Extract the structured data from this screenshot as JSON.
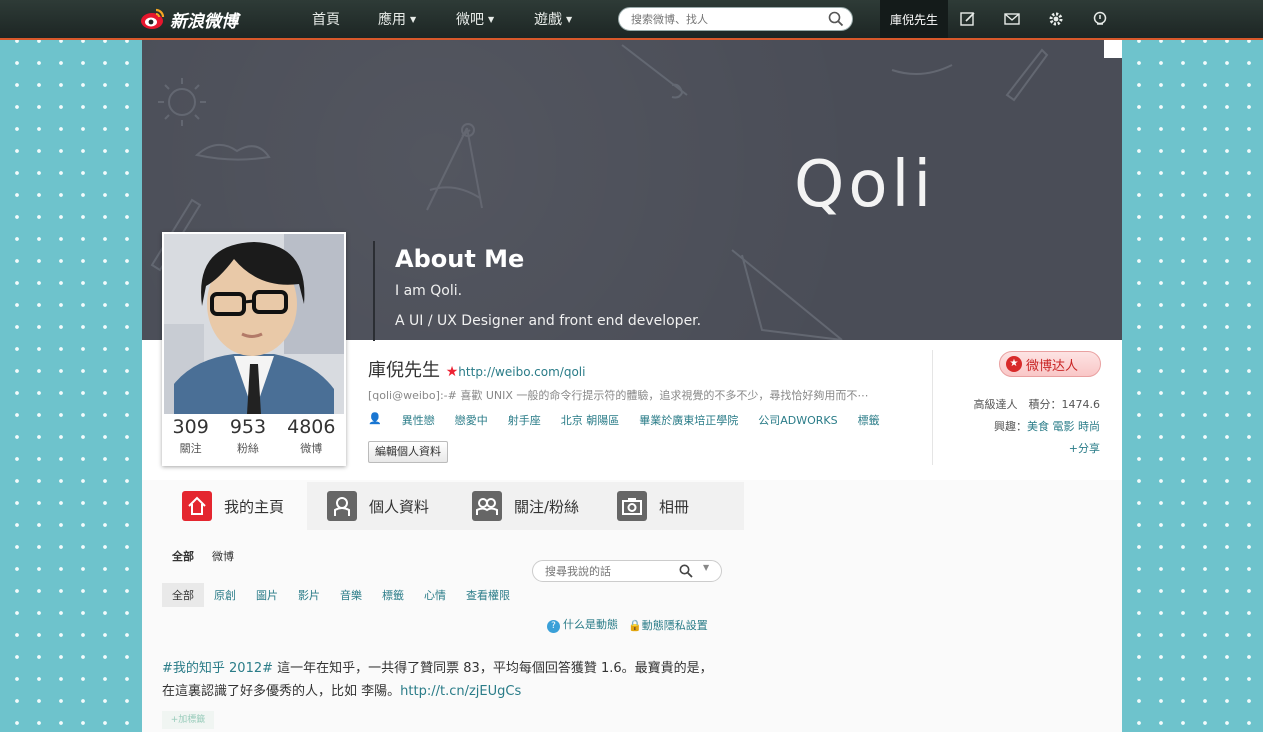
{
  "topbar": {
    "logo_text": "新浪微博",
    "nav": [
      {
        "label": "首頁"
      },
      {
        "label": "應用"
      },
      {
        "label": "微吧"
      },
      {
        "label": "遊戲"
      }
    ],
    "search_placeholder": "搜索微博、找人",
    "username": "庫倪先生",
    "icons": [
      "compose-icon",
      "mail-icon",
      "gear-icon",
      "notification-icon"
    ]
  },
  "banner": {
    "brand": "Qoli",
    "about_title": "About Me",
    "about_line1": "I am Qoli.",
    "about_line2": "A UI / UX Designer and front end developer."
  },
  "stats": [
    {
      "num": "309",
      "label": "關注"
    },
    {
      "num": "953",
      "label": "粉絲"
    },
    {
      "num": "4806",
      "label": "微博"
    }
  ],
  "profile": {
    "name": "庫倪先生",
    "url": "http://weibo.com/qoli",
    "bio": "[qoli@weibo]:-# 喜歡 UNIX 一般的命令行提示符的體驗，追求視覺的不多不少，尋找恰好夠用而不⋯",
    "tags": [
      "異性戀",
      "戀愛中",
      "射手座",
      "北京 朝陽區",
      "畢業於廣東培正學院",
      "公司ADWORKS",
      "標籤"
    ],
    "edit_button": "編輯個人資料",
    "expert_badge": "微博达人",
    "level_line": "高級達人　積分：1474.6",
    "interests_label": "興趣：",
    "interests": [
      "美食",
      "電影",
      "時尚"
    ],
    "share": "+分享"
  },
  "tabs": [
    {
      "label": "我的主頁",
      "active": true
    },
    {
      "label": "個人資料",
      "active": false
    },
    {
      "label": "關注/粉絲",
      "active": false
    },
    {
      "label": "相冊",
      "active": false
    }
  ],
  "subnav": [
    "全部",
    "微博"
  ],
  "feed_search_placeholder": "搜尋我說的話",
  "filters": [
    "全部",
    "原創",
    "圖片",
    "影片",
    "音樂",
    "標籤",
    "心情",
    "查看權限"
  ],
  "hint": {
    "what": "什么是動態",
    "privacy": "動態隱私設置"
  },
  "post": {
    "hashtag": "#我的知乎 2012#",
    "text": " 這一年在知乎，一共得了贊同票 83，平均每個回答獲贊 1.6。最寶貴的是，在這裏認識了好多優秀的人，比如 李陽。",
    "link": "http://t.cn/zjEUgCs",
    "tag": "+加標籤"
  },
  "colors": {
    "accent": "#d7582b",
    "link": "#2a7c88",
    "badge_red": "#d82a2a",
    "background": "#6ec3cc"
  }
}
